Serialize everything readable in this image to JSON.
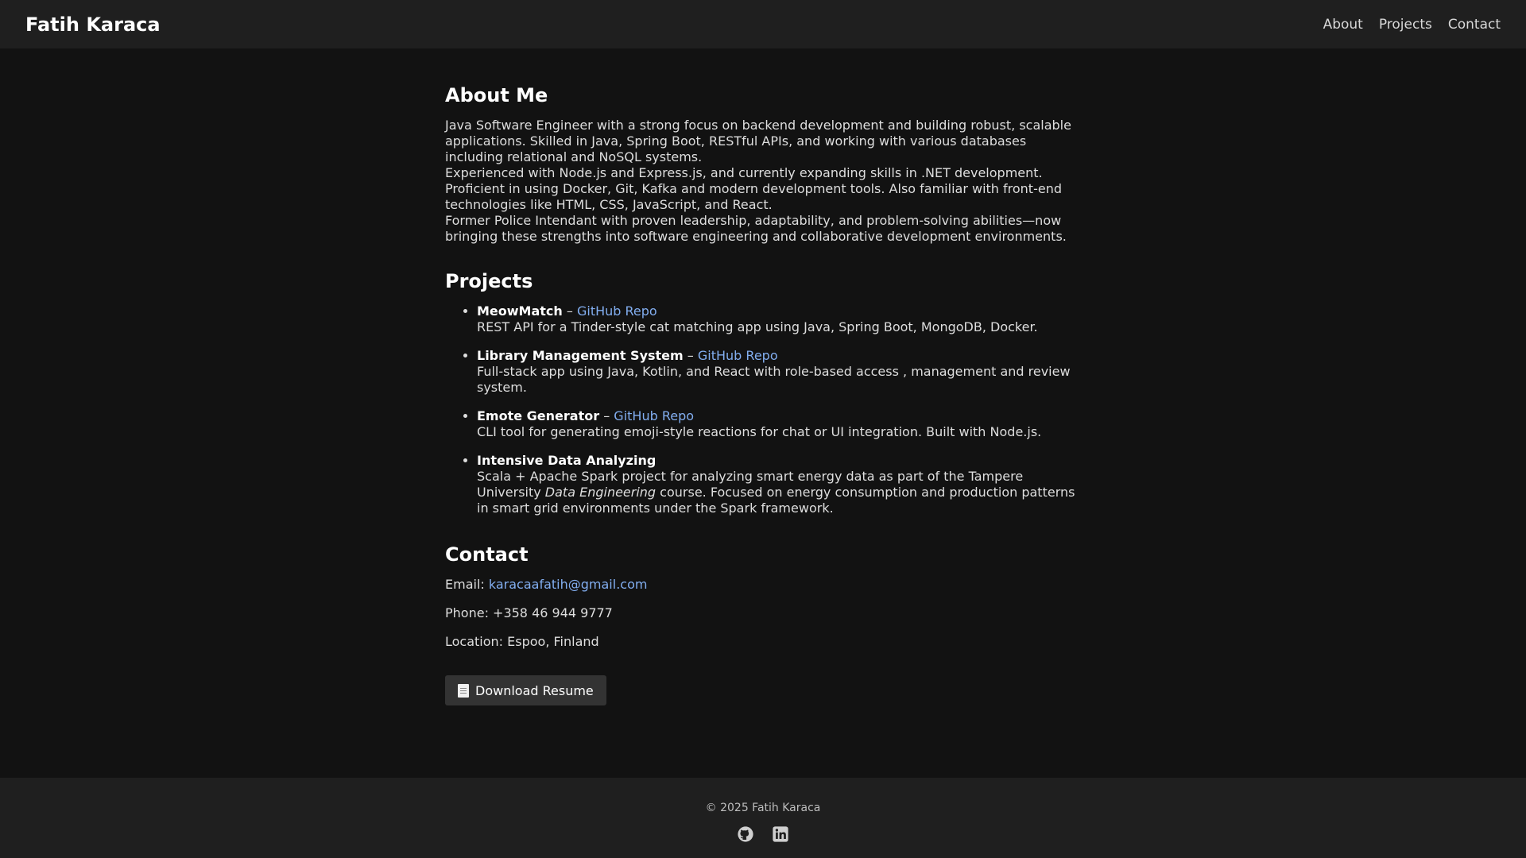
{
  "header": {
    "brand": "Fatih Karaca",
    "nav": [
      "About",
      "Projects",
      "Contact"
    ]
  },
  "about": {
    "heading": "About Me",
    "paragraphs": [
      "Java Software Engineer with a strong focus on backend development and building robust, scalable applications. Skilled in Java, Spring Boot, RESTful APIs, and working with various databases including relational and NoSQL systems.",
      "Experienced with Node.js and Express.js, and currently expanding skills in .NET development. Proficient in using Docker, Git, Kafka and modern development tools. Also familiar with front-end technologies like HTML, CSS, JavaScript, and React.",
      "Former Police Intendant with proven leadership, adaptability, and problem-solving abilities—now bringing these strengths into software engineering and collaborative development environments."
    ]
  },
  "projects": {
    "heading": "Projects",
    "separator": "–",
    "items": [
      {
        "name": "MeowMatch",
        "link": "GitHub Repo",
        "desc": "REST API for a Tinder-style cat matching app using Java, Spring Boot, MongoDB, Docker."
      },
      {
        "name": "Library Management System",
        "link": "GitHub Repo",
        "desc": "Full-stack app using Java, Kotlin, and React with role-based access , management and review system."
      },
      {
        "name": "Emote Generator",
        "link": "GitHub Repo",
        "desc": "CLI tool for generating emoji-style reactions for chat or UI integration. Built with Node.js."
      },
      {
        "name": "Intensive Data Analyzing",
        "desc_pre": "Scala + Apache Spark project for analyzing smart energy data as part of the Tampere University ",
        "desc_em": "Data Engineering",
        "desc_post": " course. Focused on energy consumption and production patterns in smart grid environments under the Spark framework."
      }
    ]
  },
  "contact": {
    "heading": "Contact",
    "email_label": "Email:",
    "email": "karacaafatih@gmail.com",
    "phone": "Phone: +358 46 944 9777",
    "location": "Location: Espoo, Finland",
    "resume_button": "Download Resume",
    "resume_icon": "document-icon"
  },
  "footer": {
    "copyright": "© 2025 Fatih Karaca",
    "socials": [
      "github-icon",
      "linkedin-icon"
    ]
  },
  "colors": {
    "background": "#121212",
    "bar": "#1f1f1f",
    "link": "#82aef0",
    "button": "#333333"
  }
}
